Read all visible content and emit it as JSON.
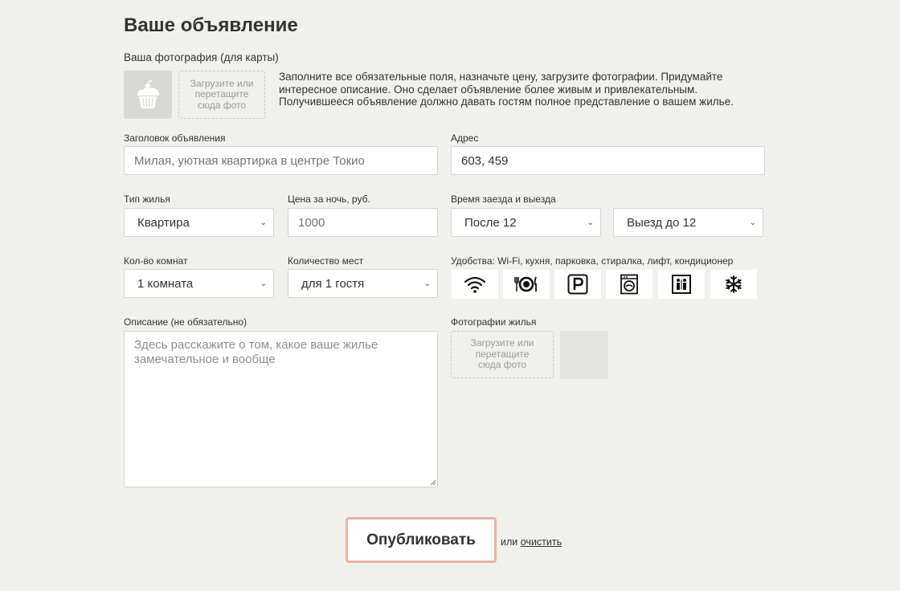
{
  "page": {
    "title": "Ваше объявление"
  },
  "avatar": {
    "label": "Ваша фотография (для карты)",
    "icon": "cupcake-icon",
    "upload_text": "Загрузите или перетащите сюда фото"
  },
  "hint": "Заполните все обязательные поля, назначьте цену, загрузите фотографии. Придумайте интересное описание. Оно сделает объявление более живым и привлекательным. Получившееся объявление должно давать гостям полное представление о вашем жилье.",
  "listing_title": {
    "label": "Заголовок объявления",
    "placeholder": "Милая, уютная квартирка в центре Токио"
  },
  "address": {
    "label": "Адрес",
    "value": "603, 459"
  },
  "housing_type": {
    "label": "Тип жилья",
    "value": "Квартира"
  },
  "price": {
    "label": "Цена за ночь, руб.",
    "placeholder": "1000"
  },
  "checkin_checkout": {
    "label": "Время заезда и выезда",
    "checkin": "После 12",
    "checkout": "Выезд до 12"
  },
  "rooms": {
    "label": "Кол-во комнат",
    "value": "1 комната"
  },
  "guests": {
    "label": "Количество мест",
    "value": "для 1 гостя"
  },
  "features": {
    "label": "Удобства: Wi-Fi, кухня, парковка, стиралка, лифт, кондиционер",
    "items": [
      "wifi-icon",
      "dishwasher-icon",
      "parking-icon",
      "washer-icon",
      "elevator-icon",
      "conditioner-icon"
    ]
  },
  "description": {
    "label": "Описание (не обязательно)",
    "placeholder": "Здесь расскажите о том, какое ваше жилье замечательное и вообще"
  },
  "photos": {
    "label": "Фотографии жилья",
    "upload_text": "Загрузите или перетащите сюда фото"
  },
  "actions": {
    "publish": "Опубликовать",
    "or_text": "или",
    "clear": "очистить"
  },
  "colors": {
    "background": "#f0f0ec",
    "publish_border": "#e7b5a7",
    "icon_tile": "#ffffff"
  }
}
